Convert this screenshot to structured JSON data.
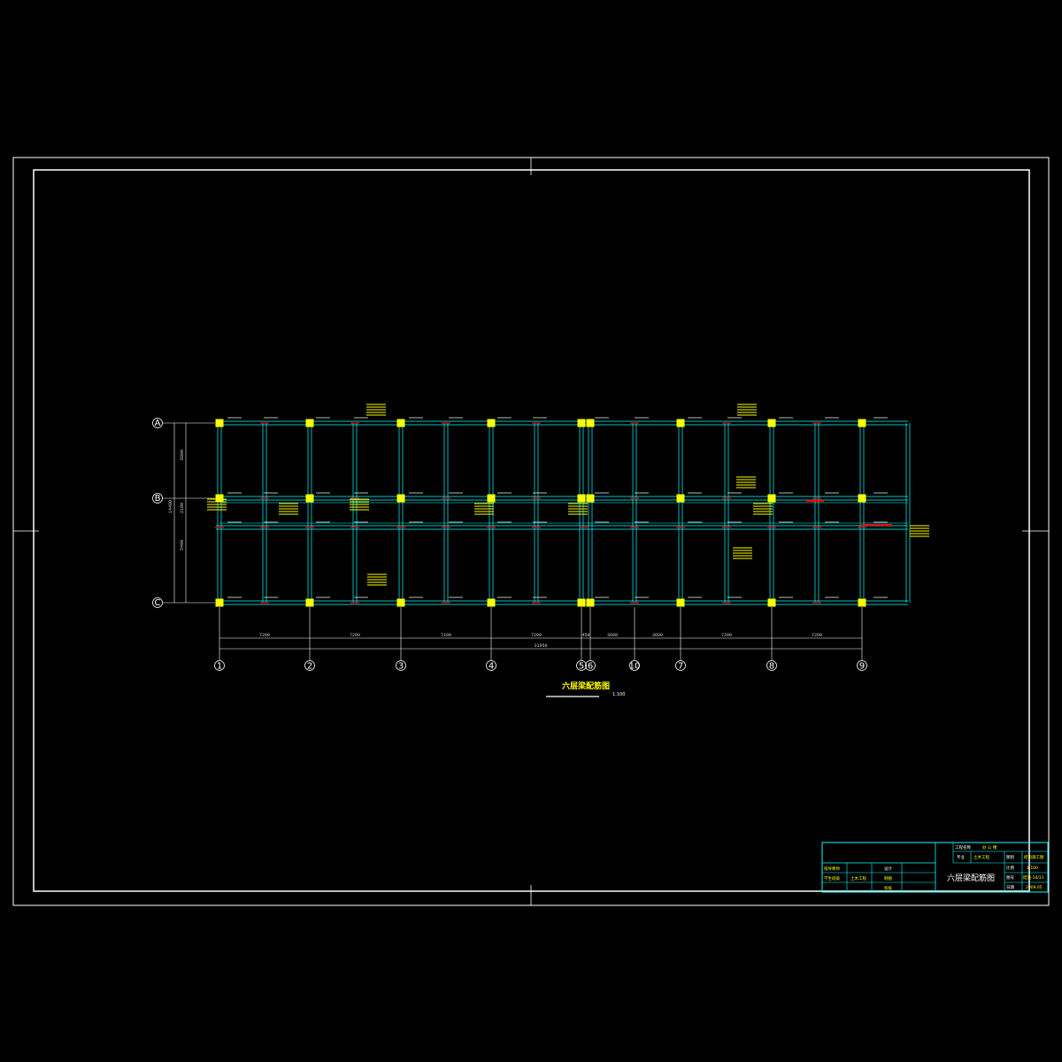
{
  "drawing": {
    "plan_title": "六层梁配筋图",
    "plan_scale": "1:100",
    "total_dim": "31050",
    "grid_columns": [
      "1",
      "2",
      "3",
      "4",
      "5",
      "6",
      "10",
      "7",
      "8",
      "9"
    ],
    "grid_rows": [
      "A",
      "B",
      "C"
    ],
    "column_spans": [
      "7200",
      "7200",
      "7200",
      "7200",
      "450",
      "3600",
      "3600",
      "7200",
      "7200"
    ],
    "row_dims": [
      "6000",
      "2100",
      "5400",
      "14400"
    ]
  },
  "title_block": {
    "drawing_name": "六层梁配筋图",
    "project_label": "工程名称",
    "project_value": "办 公 楼",
    "major_label": "专业",
    "major_value": "土木工程",
    "type_label": "图别",
    "type_value": "结构施工图",
    "scale_label": "比例",
    "scale_value": "1:100",
    "no_label": "图号",
    "no_value": "结施-10/11",
    "date_label": "日期",
    "date_value": "2009.05",
    "row1_a": "指导教师",
    "row2_a": "学生班级",
    "row2_b": "土木工程",
    "design_label": "设计",
    "draw_label": "制图",
    "check_label": "校核"
  },
  "colors": {
    "frame": "#ffffff",
    "beam": "#00ffff",
    "column": "#ffff00",
    "rebar": "#ff0000",
    "annotation": "#ffff00"
  }
}
